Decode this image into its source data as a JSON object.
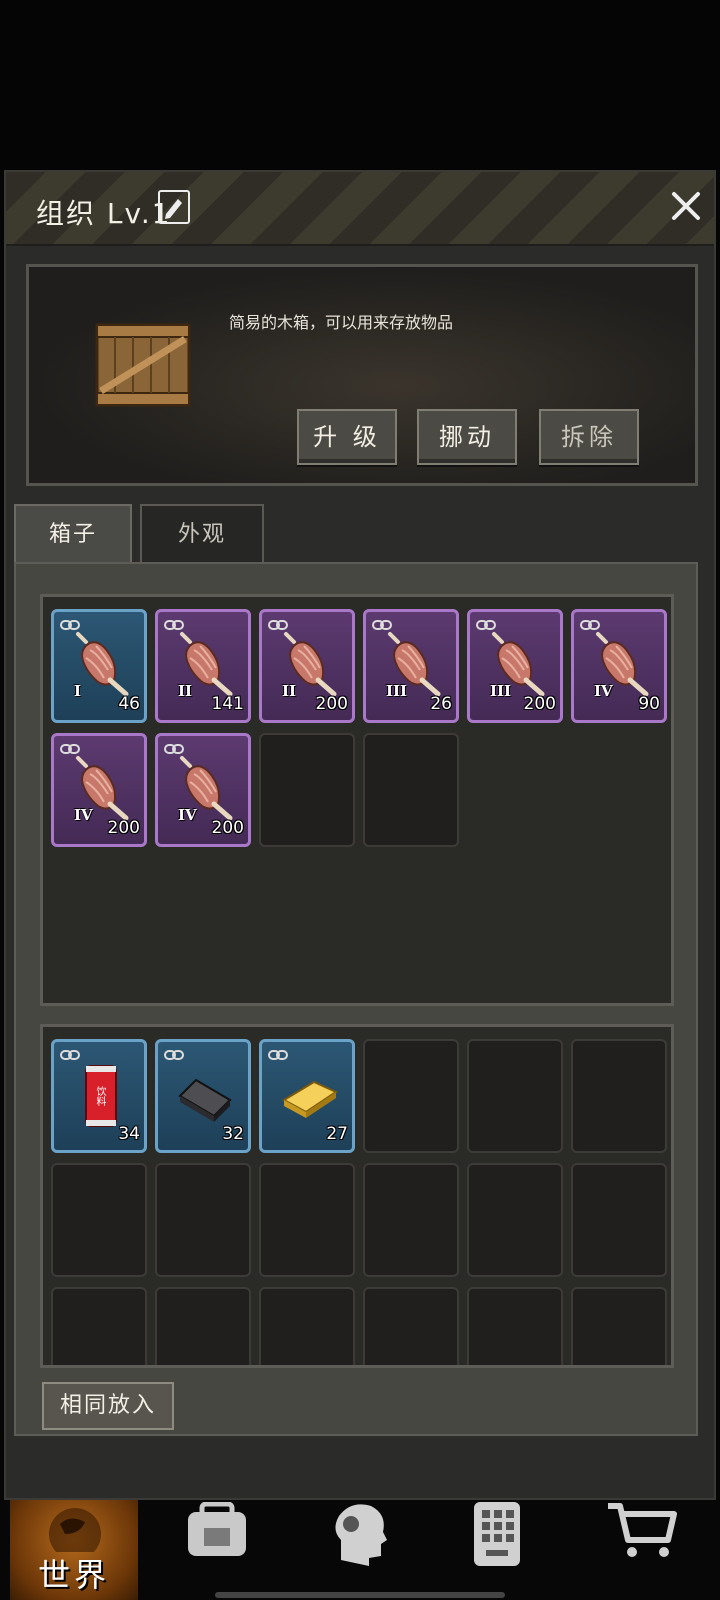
{
  "header": {
    "title": "组织 Lv.1"
  },
  "info": {
    "description": "简易的木箱，可以用来存放物品",
    "buttons": {
      "upgrade": "升 级",
      "move": "挪动",
      "demolish": "拆除"
    }
  },
  "tabs": [
    {
      "label": "箱子",
      "active": true
    },
    {
      "label": "外观",
      "active": false
    }
  ],
  "storage_items": [
    {
      "icon": "meat-leg-icon",
      "tier": "I",
      "quantity": "46",
      "rarity": "blue"
    },
    {
      "icon": "meat-leg-icon",
      "tier": "II",
      "quantity": "141",
      "rarity": "purple"
    },
    {
      "icon": "meat-leg-icon",
      "tier": "II",
      "quantity": "200",
      "rarity": "purple"
    },
    {
      "icon": "meat-leg-icon",
      "tier": "III",
      "quantity": "26",
      "rarity": "purple"
    },
    {
      "icon": "meat-leg-icon",
      "tier": "III",
      "quantity": "200",
      "rarity": "purple"
    },
    {
      "icon": "meat-leg-icon",
      "tier": "IV",
      "quantity": "90",
      "rarity": "purple"
    },
    {
      "icon": "meat-leg-icon",
      "tier": "IV",
      "quantity": "200",
      "rarity": "purple"
    },
    {
      "icon": "meat-leg-icon",
      "tier": "IV",
      "quantity": "200",
      "rarity": "purple"
    }
  ],
  "inventory_items": [
    {
      "icon": "drink-can-icon",
      "label": "饮料",
      "quantity": "34",
      "rarity": "blue"
    },
    {
      "icon": "iron-bar-icon",
      "quantity": "32",
      "rarity": "blue"
    },
    {
      "icon": "gold-bar-icon",
      "quantity": "27",
      "rarity": "blue"
    }
  ],
  "same_put_in": "相同放入",
  "nav": {
    "world": "世界"
  },
  "colors": {
    "rare_blue": "#6aa2c8",
    "epic_purple": "#a978c9"
  }
}
